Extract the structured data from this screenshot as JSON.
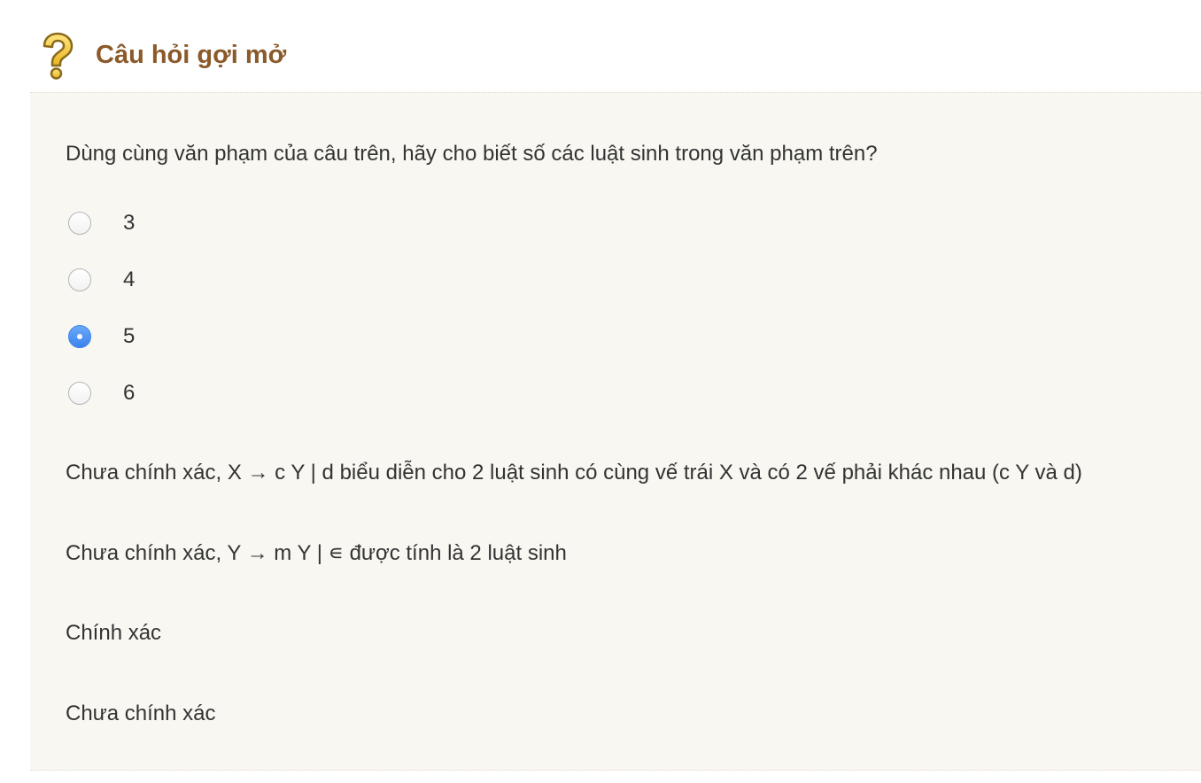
{
  "header": {
    "icon": "question-mark-icon",
    "title": "Câu hỏi gợi mở",
    "title_color": "#8a5a2b"
  },
  "question": {
    "text": "Dùng cùng văn phạm của câu trên, hãy cho biết số các luật sinh trong văn phạm trên?",
    "selected_value": "5",
    "options": [
      {
        "label": "3",
        "checked": false
      },
      {
        "label": "4",
        "checked": false
      },
      {
        "label": "5",
        "checked": true
      },
      {
        "label": "6",
        "checked": false
      }
    ]
  },
  "feedback": [
    "Chưa chính xác, X → c Y | d biểu diễn cho 2 luật sinh có cùng vế trái X và có 2 vế phải khác nhau (c Y và d)",
    "Chưa chính xác, Y → m Y | ∊ được tính là 2 luật sinh",
    "Chính xác",
    "Chưa chính xác"
  ],
  "colors": {
    "panel_background": "#f8f7f2",
    "radio_selected": "#3b82ef",
    "text": "#333333"
  }
}
